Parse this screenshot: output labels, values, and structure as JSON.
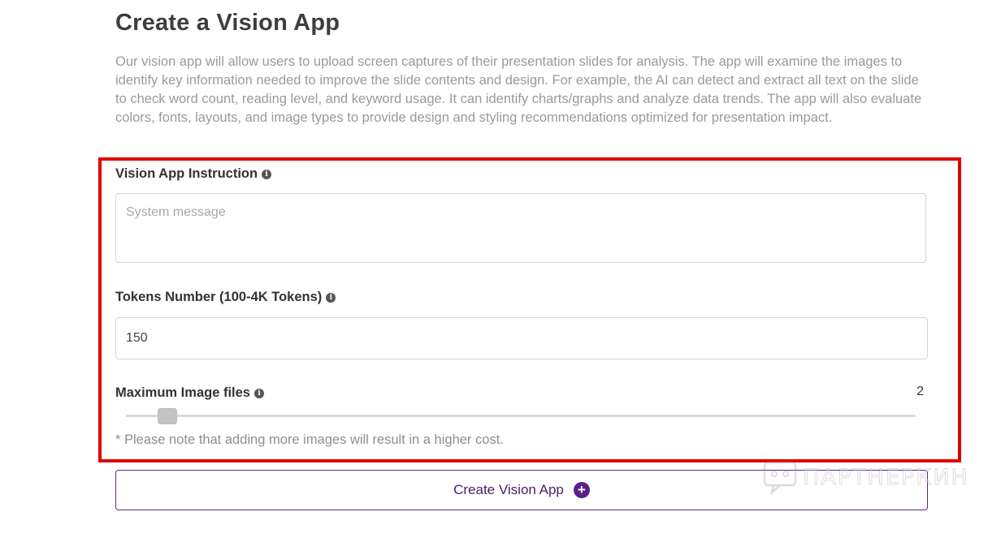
{
  "page": {
    "title": "Create a Vision App",
    "description": "Our vision app will allow users to upload screen captures of their presentation slides for analysis. The app will examine the images to identify key information needed to improve the slide contents and design. For example, the AI can detect and extract all text on the slide to check word count, reading level, and keyword usage. It can identify charts/graphs and analyze data trends. The app will also evaluate colors, fonts, layouts, and image types to provide design and styling recommendations optimized for presentation impact."
  },
  "form": {
    "instruction": {
      "label": "Vision App Instruction",
      "placeholder": "System message",
      "value": ""
    },
    "tokens": {
      "label": "Tokens Number (100-4K Tokens)",
      "value": "150"
    },
    "max_images": {
      "label": "Maximum Image files",
      "value": "2",
      "note": "* Please note that adding more images will result in a higher cost."
    },
    "info_icon": "info-circle-icon"
  },
  "actions": {
    "create_label": "Create Vision App",
    "create_icon": "plus-circle-icon"
  },
  "watermark": {
    "text": "ПАРТНЕРКИН"
  },
  "colors": {
    "highlight": "#e00000",
    "button_border": "#5c2a7e",
    "button_text": "#4a1f6a",
    "plus_icon": "#5b1f8a"
  }
}
